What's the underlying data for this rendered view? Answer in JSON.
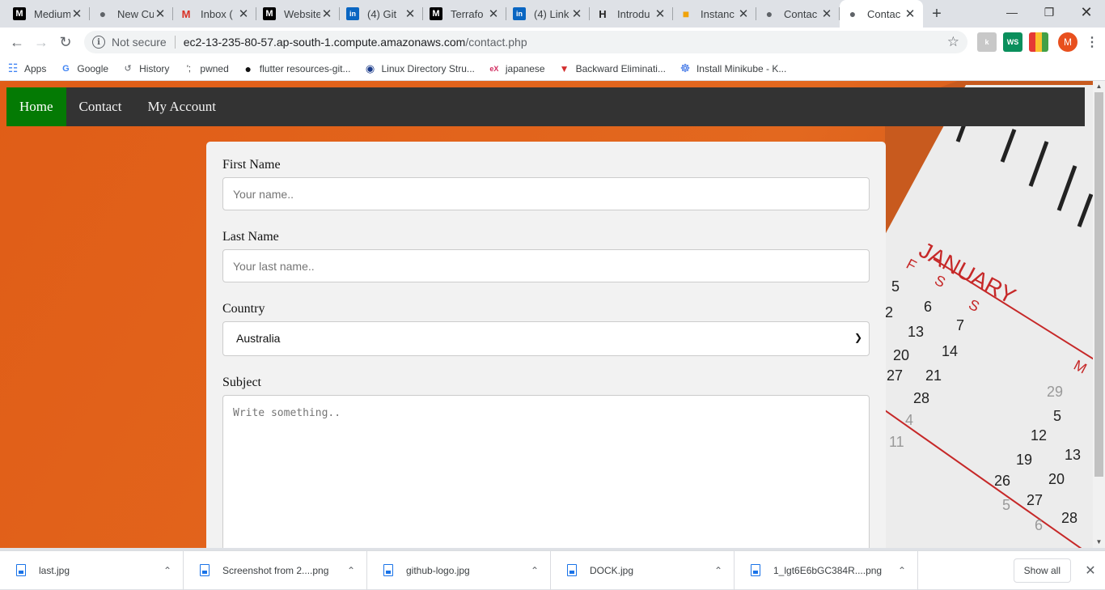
{
  "tabs": [
    {
      "title": "Medium",
      "icon": "medium-icon",
      "active": false
    },
    {
      "title": "New Cu",
      "icon": "globe-icon",
      "active": false
    },
    {
      "title": "Inbox (",
      "icon": "gmail-icon",
      "active": false
    },
    {
      "title": "Website",
      "icon": "medium-icon",
      "active": false
    },
    {
      "title": "(4) Git",
      "icon": "linkedin-icon",
      "active": false
    },
    {
      "title": "Terrafo",
      "icon": "medium-icon",
      "active": false
    },
    {
      "title": "(4) Link",
      "icon": "linkedin-icon",
      "active": false
    },
    {
      "title": "Introdu",
      "icon": "hashicorp-icon",
      "active": false
    },
    {
      "title": "Instanc",
      "icon": "aws-icon",
      "active": false
    },
    {
      "title": "Contac",
      "icon": "globe-icon",
      "active": false
    },
    {
      "title": "Contac",
      "icon": "globe-icon",
      "active": true
    }
  ],
  "toolbar": {
    "security": "Not secure",
    "url_host": "ec2-13-235-80-57.ap-south-1.compute.amazonaws.com",
    "url_path": "/contact.php",
    "avatar_letter": "M"
  },
  "bookmarks": [
    {
      "label": "Apps",
      "icon": "apps-grid-icon"
    },
    {
      "label": "Google",
      "icon": "google-icon"
    },
    {
      "label": "History",
      "icon": "history-icon"
    },
    {
      "label": "pwned",
      "icon": "pwned-icon"
    },
    {
      "label": "flutter resources-git...",
      "icon": "github-icon"
    },
    {
      "label": "Linux Directory Stru...",
      "icon": "linux-icon"
    },
    {
      "label": "japanese",
      "icon": "edx-icon"
    },
    {
      "label": "Backward Eliminati...",
      "icon": "triangle-icon"
    },
    {
      "label": "Install Minikube - K...",
      "icon": "kubernetes-icon"
    }
  ],
  "nav": {
    "home": "Home",
    "contact": "Contact",
    "account": "My Account"
  },
  "form": {
    "first_name_label": "First Name",
    "first_name_placeholder": "Your name..",
    "last_name_label": "Last Name",
    "last_name_placeholder": "Your last name..",
    "country_label": "Country",
    "country_value": "Australia",
    "subject_label": "Subject",
    "subject_placeholder": "Write something.."
  },
  "calendar": {
    "month": "JANUARY",
    "day_headers": [
      "F",
      "S",
      "S"
    ],
    "next_month_initial": "M"
  },
  "downloads": {
    "items": [
      "last.jpg",
      "Screenshot from 2....png",
      "github-logo.jpg",
      "DOCK.jpg",
      "1_lgt6E6bGC384R....png"
    ],
    "show_all": "Show all"
  },
  "colors": {
    "nav_bg": "#333333",
    "nav_active": "#047a04",
    "page_bg": "#e0631f",
    "form_bg": "#f2f2f2"
  }
}
